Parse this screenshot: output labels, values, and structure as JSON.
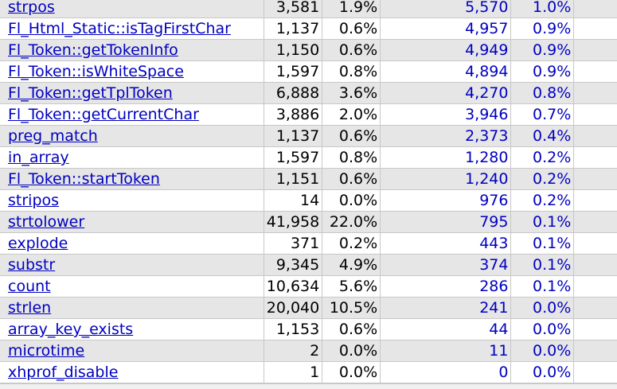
{
  "rows": [
    {
      "fn": "strpos",
      "calls": "3,581",
      "calls_pct": "1.9%",
      "excl": "5,570",
      "excl_pct": "1.0%"
    },
    {
      "fn": "Fl_Html_Static::isTagFirstChar",
      "calls": "1,137",
      "calls_pct": "0.6%",
      "excl": "4,957",
      "excl_pct": "0.9%"
    },
    {
      "fn": "Fl_Token::getTokenInfo",
      "calls": "1,150",
      "calls_pct": "0.6%",
      "excl": "4,949",
      "excl_pct": "0.9%"
    },
    {
      "fn": "Fl_Token::isWhiteSpace",
      "calls": "1,597",
      "calls_pct": "0.8%",
      "excl": "4,894",
      "excl_pct": "0.9%"
    },
    {
      "fn": "Fl_Token::getTplToken",
      "calls": "6,888",
      "calls_pct": "3.6%",
      "excl": "4,270",
      "excl_pct": "0.8%"
    },
    {
      "fn": "Fl_Token::getCurrentChar",
      "calls": "3,886",
      "calls_pct": "2.0%",
      "excl": "3,946",
      "excl_pct": "0.7%"
    },
    {
      "fn": "preg_match",
      "calls": "1,137",
      "calls_pct": "0.6%",
      "excl": "2,373",
      "excl_pct": "0.4%"
    },
    {
      "fn": "in_array",
      "calls": "1,597",
      "calls_pct": "0.8%",
      "excl": "1,280",
      "excl_pct": "0.2%"
    },
    {
      "fn": "Fl_Token::startToken",
      "calls": "1,151",
      "calls_pct": "0.6%",
      "excl": "1,240",
      "excl_pct": "0.2%"
    },
    {
      "fn": "stripos",
      "calls": "14",
      "calls_pct": "0.0%",
      "excl": "976",
      "excl_pct": "0.2%"
    },
    {
      "fn": "strtolower",
      "calls": "41,958",
      "calls_pct": "22.0%",
      "excl": "795",
      "excl_pct": "0.1%"
    },
    {
      "fn": "explode",
      "calls": "371",
      "calls_pct": "0.2%",
      "excl": "443",
      "excl_pct": "0.1%"
    },
    {
      "fn": "substr",
      "calls": "9,345",
      "calls_pct": "4.9%",
      "excl": "374",
      "excl_pct": "0.1%"
    },
    {
      "fn": "count",
      "calls": "10,634",
      "calls_pct": "5.6%",
      "excl": "286",
      "excl_pct": "0.1%"
    },
    {
      "fn": "strlen",
      "calls": "20,040",
      "calls_pct": "10.5%",
      "excl": "241",
      "excl_pct": "0.0%"
    },
    {
      "fn": "array_key_exists",
      "calls": "1,153",
      "calls_pct": "0.6%",
      "excl": "44",
      "excl_pct": "0.0%"
    },
    {
      "fn": "microtime",
      "calls": "2",
      "calls_pct": "0.0%",
      "excl": "11",
      "excl_pct": "0.0%"
    },
    {
      "fn": "xhprof_disable",
      "calls": "1",
      "calls_pct": "0.0%",
      "excl": "0",
      "excl_pct": "0.0%"
    }
  ],
  "colors": {
    "link": "#0000c0",
    "row_alt": "#e6e6e6",
    "row": "#ffffff",
    "grid": "#c8c8c8"
  }
}
